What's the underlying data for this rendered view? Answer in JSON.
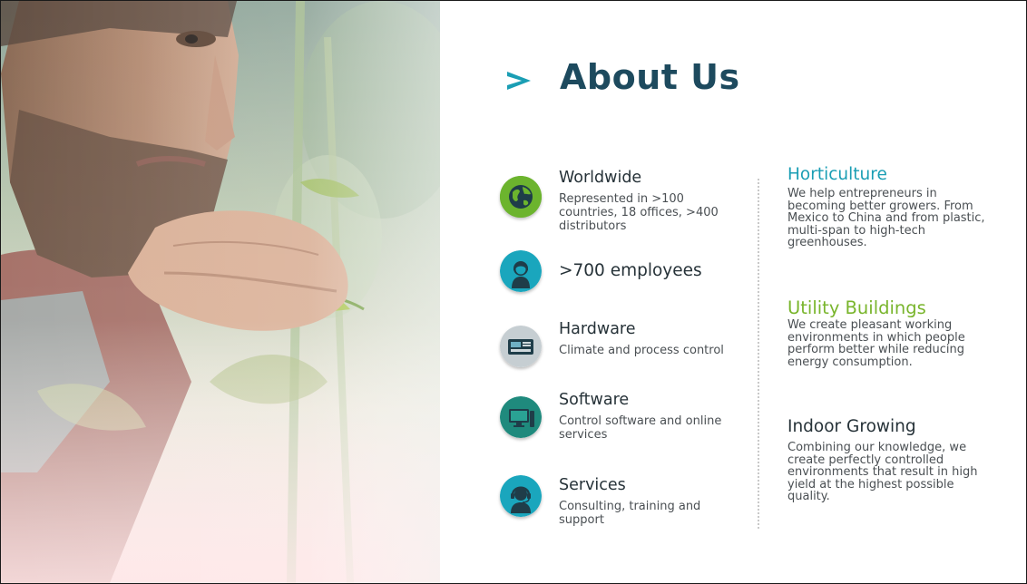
{
  "title": "About Us",
  "colors": {
    "title": "#1d4a5e",
    "chevron": "#1a9eb4",
    "horticulture": "#1a9eb4",
    "utility": "#79b52c",
    "indoor": "#263238"
  },
  "features": [
    {
      "icon": "globe-icon",
      "title": "Worldwide",
      "description": "Represented in >100 countries, 18 offices, >400 distributors"
    },
    {
      "icon": "person-icon",
      "title": ">700 employees",
      "description": ""
    },
    {
      "icon": "controller-hardware-icon",
      "title": "Hardware",
      "description": "Climate and process control"
    },
    {
      "icon": "computer-icon",
      "title": "Software",
      "description": "Control software and online services"
    },
    {
      "icon": "headset-support-icon",
      "title": "Services",
      "description": "Consulting, training and support"
    }
  ],
  "sectors": [
    {
      "title": "Horticulture",
      "description": "We help entrepreneurs in becoming better growers. From Mexico to China and from plastic, multi-span to high-tech greenhouses."
    },
    {
      "title": "Utility Buildings",
      "description": "We create pleasant working environments in which people perform better while reducing energy consumption."
    },
    {
      "title": "Indoor Growing",
      "description": "Combining our knowledge, we create perfectly controlled environments that result in high yield at the highest possible quality."
    }
  ]
}
